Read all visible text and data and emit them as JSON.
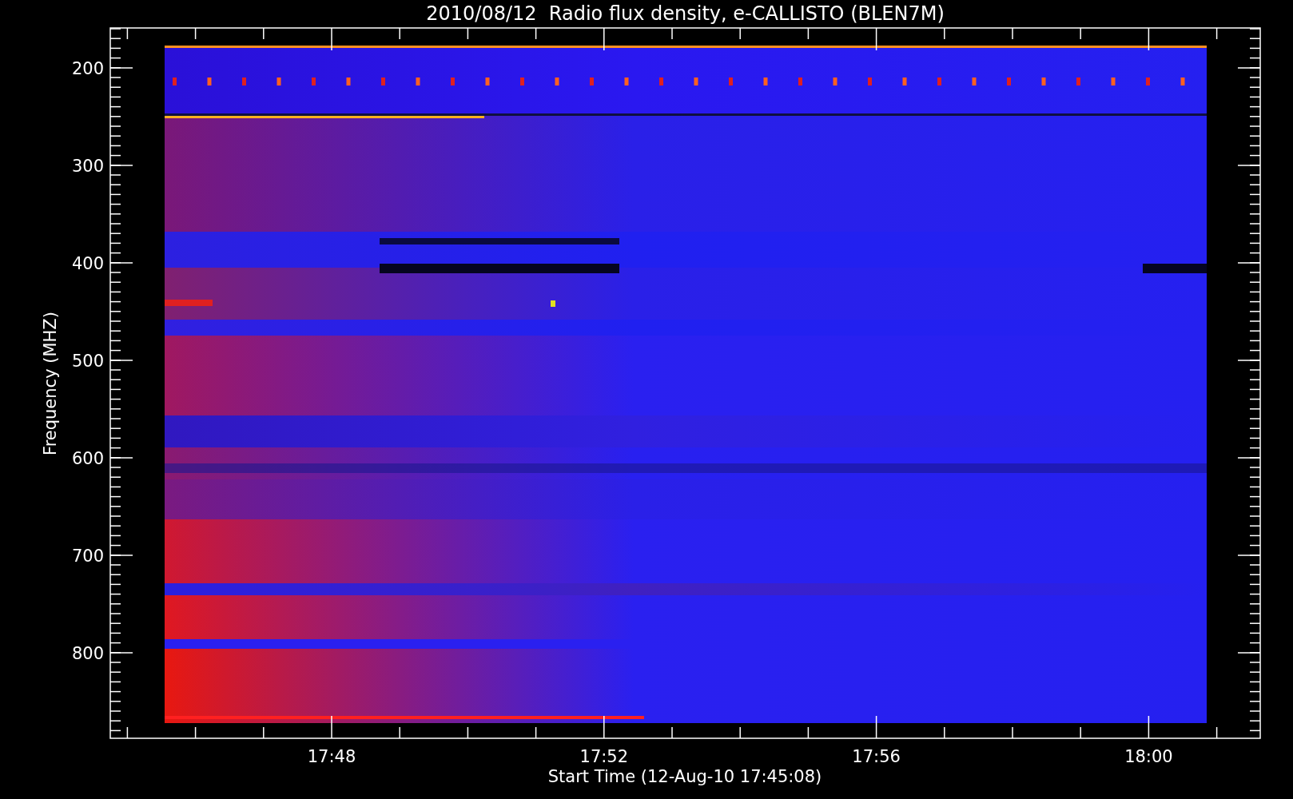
{
  "title": "2010/08/12  Radio flux density, e-CALLISTO (BLEN7M)",
  "y_axis": {
    "label": "Frequency (MHZ)",
    "ticks": [
      "200",
      "300",
      "400",
      "500",
      "600",
      "700",
      "800"
    ]
  },
  "x_axis": {
    "label": "Start Time (12-Aug-10 17:45:08)",
    "ticks": [
      "17:48",
      "17:52",
      "17:56",
      "18:00"
    ]
  }
}
